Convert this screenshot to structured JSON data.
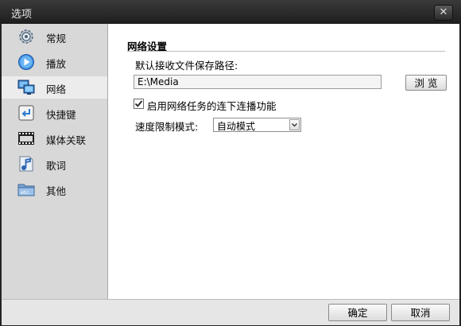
{
  "window": {
    "title": "选项",
    "close_glyph": "✕"
  },
  "sidebar": {
    "items": [
      {
        "label": "常规",
        "icon": "gear-icon"
      },
      {
        "label": "播放",
        "icon": "play-icon"
      },
      {
        "label": "网络",
        "icon": "network-icon",
        "active": true
      },
      {
        "label": "快捷键",
        "icon": "keyboard-icon"
      },
      {
        "label": "媒体关联",
        "icon": "film-icon"
      },
      {
        "label": "歌词",
        "icon": "music-icon"
      },
      {
        "label": "其他",
        "icon": "etc-folder-icon"
      }
    ]
  },
  "network": {
    "section_title": "网络设置",
    "save_path_label": "默认接收文件保存路径:",
    "save_path_value": "E:\\Media",
    "browse_label": "浏 览",
    "checkbox_label": "启用网络任务的连下连播功能",
    "checkbox_checked": true,
    "speed_label": "速度限制模式:",
    "speed_value": "自动模式"
  },
  "footer": {
    "ok_label": "确定",
    "cancel_label": "取消"
  },
  "colors": {
    "titlebar": "#2b2b2b",
    "sidebar": "#d8d8d8",
    "active_item": "#ececec"
  }
}
